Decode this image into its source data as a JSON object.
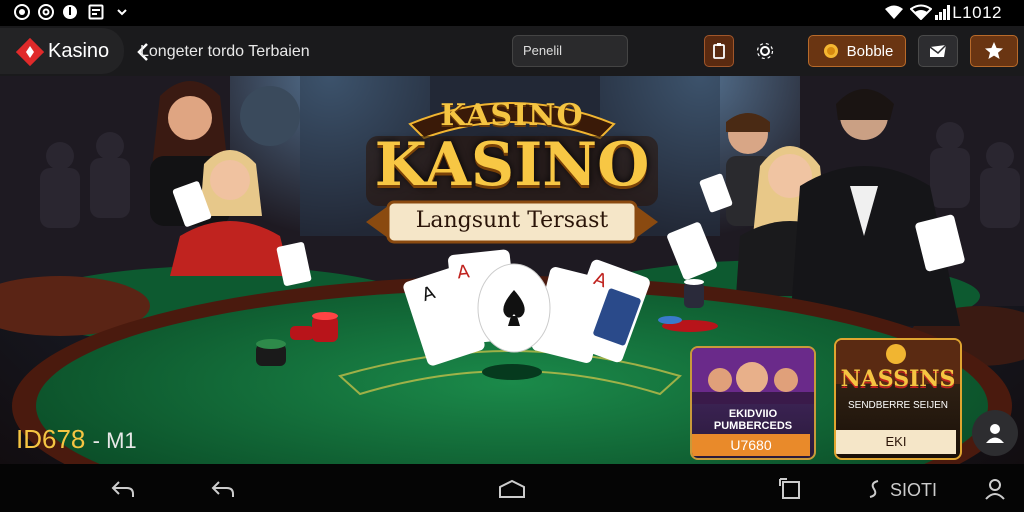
{
  "status_bar": {
    "time": "L1012",
    "left_icons": [
      "app-circle-icon",
      "at-sign-icon",
      "chrome-circle-icon",
      "image-icon",
      "chevron-down-icon"
    ],
    "right_icons": [
      "wifi-icon",
      "wifi-signal-icon",
      "signal-bars-icon"
    ]
  },
  "topbar": {
    "brand": "Kasino",
    "breadcrumb": "Longeter tordo Terbaien",
    "search_placeholder": "Penelil",
    "coin_label": "Bobble"
  },
  "hero": {
    "logo_small": "KASINO",
    "logo_big": "KASINO",
    "ribbon": "Langsunt Tersast"
  },
  "promos": [
    {
      "title": "EKIDVIIO PUMBERCEDS",
      "button": "U7680"
    },
    {
      "title": "NASSINS",
      "subtitle": "SENDBERRE SEIJEN",
      "button": "EKI"
    }
  ],
  "player_id": {
    "id": "ID678",
    "suffix": "- M1"
  },
  "bottom_nav": {
    "right_label": "SIOTI"
  },
  "colors": {
    "gold": "#f5c542",
    "felt": "#0f6a3a",
    "accent": "#c0231f",
    "orange_button": "#7a3a10"
  }
}
